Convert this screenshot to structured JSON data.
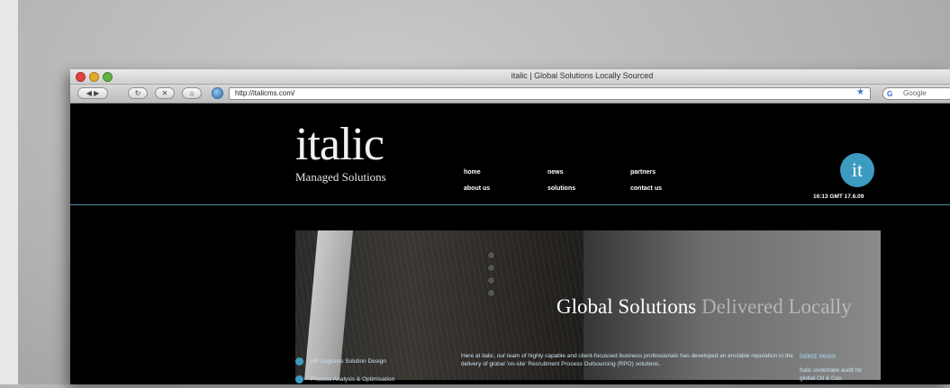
{
  "browser": {
    "window_title": "italic | Global Solutions Locally Sourced",
    "url": "http://italicms.com/",
    "search_placeholder": "Google"
  },
  "site": {
    "logo_main": "italic",
    "logo_sub": "Managed Solutions",
    "nav": {
      "home": "home",
      "news": "news",
      "partners": "partners",
      "about_us": "about us",
      "solutions": "solutions",
      "contact_us": "contact us"
    },
    "badge": "it",
    "clock": "16:13 GMT 17.6.09",
    "hero": {
      "title_strong": "Global Solutions",
      "title_faded": "Delivered Locally"
    },
    "services": [
      {
        "label": "HR Logistics Solution Design"
      },
      {
        "label": "Process Analysis & Optimisation"
      }
    ],
    "intro": "Here at italic, our team of highly capable and client-focussed business professionals has developed an enviable reputation in the delivery of global 'on-site' Recruitment Process Outsourcing (RPO) solutions.",
    "latest_news": {
      "heading": "latest news",
      "text": "Italic undertake audit for global Oil & Gas"
    }
  },
  "colors": {
    "accent": "#3d9bc2",
    "header_rule": "#4f8fa8",
    "page_bg": "#000000"
  }
}
